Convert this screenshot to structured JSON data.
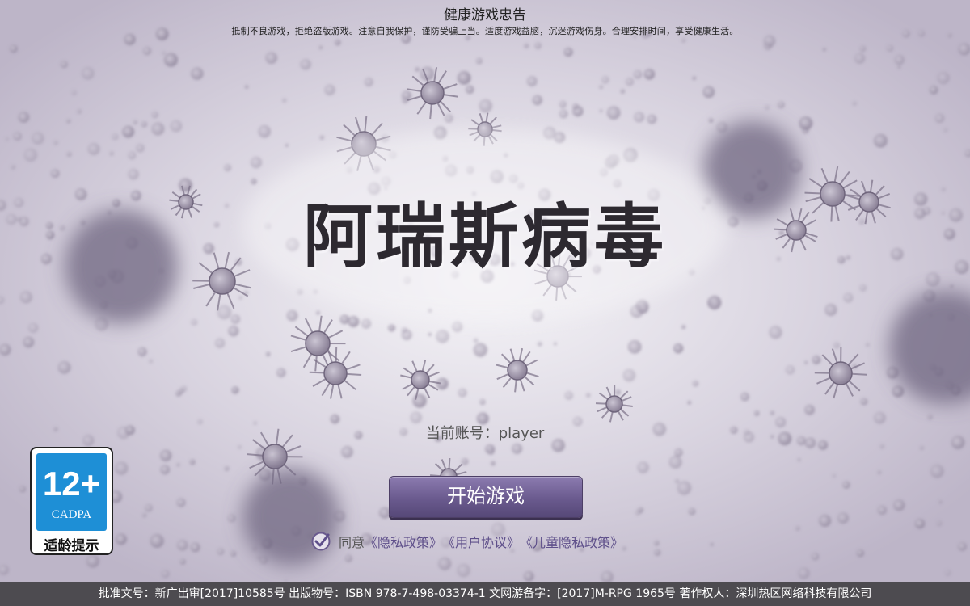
{
  "health_notice": {
    "title": "健康游戏忠告",
    "body": "抵制不良游戏，拒绝盗版游戏。注意自我保护，谨防受骗上当。适度游戏益脑，沉迷游戏伤身。合理安排时间，享受健康生活。"
  },
  "game_title": "阿瑞斯病毒",
  "account": {
    "label": "当前账号：",
    "value": "player"
  },
  "start_button": "开始游戏",
  "agreement": {
    "prefix": "同意",
    "privacy": "《隐私政策》",
    "user": "《用户协议》",
    "child_privacy": "《儿童隐私政策》",
    "checked": true
  },
  "age_rating": {
    "age": "12+",
    "org": "CADPA",
    "label": "适龄提示",
    "color": "#1e8fd6"
  },
  "footer": "批准文号：新广出审[2017]10585号  出版物号：ISBN 978-7-498-03374-1  文网游备字：[2017]M-RPG 1965号  著作权人：深圳热区网络科技有限公司",
  "colors": {
    "button_top": "#8c7bb0",
    "button_bottom": "#564878",
    "link": "#5e4f8a",
    "footer_bg": "#4d4b50"
  }
}
